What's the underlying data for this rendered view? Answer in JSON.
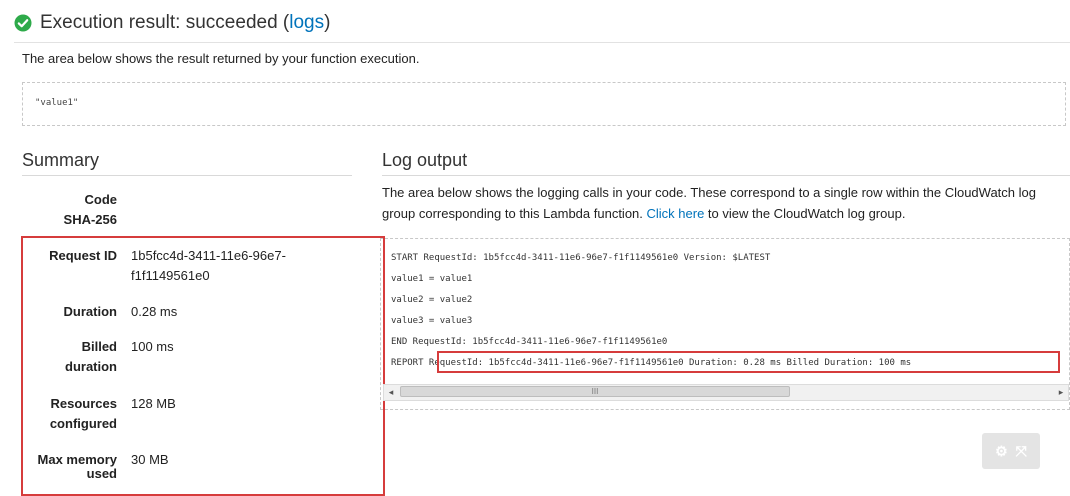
{
  "header": {
    "title": "Execution result: succeeded (",
    "logs_link": "logs",
    "title_close": ")"
  },
  "result": {
    "description": "The area below shows the result returned by your function execution.",
    "value": "\"value1\""
  },
  "summary": {
    "title": "Summary",
    "code_sha_line1": "Code",
    "code_sha_line2": "SHA-256",
    "request_id_label": "Request ID",
    "request_id_line1": "1b5fcc4d-3411-11e6-96e7-",
    "request_id_line2": "f1f1149561e0",
    "duration_label": "Duration",
    "duration_value": "0.28 ms",
    "billed_label_line1": "Billed",
    "billed_label_line2": "duration",
    "billed_value": "100 ms",
    "resources_label_line1": "Resources",
    "resources_label_line2": "configured",
    "resources_value": "128 MB",
    "max_memory_label_line1": "Max memory",
    "max_memory_label_line2": "used",
    "max_memory_value": "30 MB"
  },
  "log": {
    "title": "Log output",
    "description_before": "The area below shows the logging calls in your code. These correspond to a single row within the CloudWatch log group corresponding to this Lambda function. ",
    "click_here": "Click here",
    "description_after": " to view the CloudWatch log group.",
    "lines": [
      "START RequestId: 1b5fcc4d-3411-11e6-96e7-f1f1149561e0 Version: $LATEST",
      "value1 = value1",
      "value2 = value2",
      "value3 = value3",
      "END RequestId: 1b5fcc4d-3411-11e6-96e7-f1f1149561e0",
      "REPORT RequestId: 1b5fcc4d-3411-11e6-96e7-f1f1149561e0  Duration: 0.28 ms      Billed Duration: 100 ms"
    ],
    "scroll_left": "◂",
    "scroll_right": "▸",
    "scroll_grip": "III"
  },
  "expand_button": {
    "icons": [
      "gear-icon",
      "expand-icon"
    ],
    "gear": "⚙",
    "expand": "⤧"
  },
  "colors": {
    "success": "#2eaa4a",
    "link": "#0073bb",
    "highlight": "#d63c3c"
  }
}
